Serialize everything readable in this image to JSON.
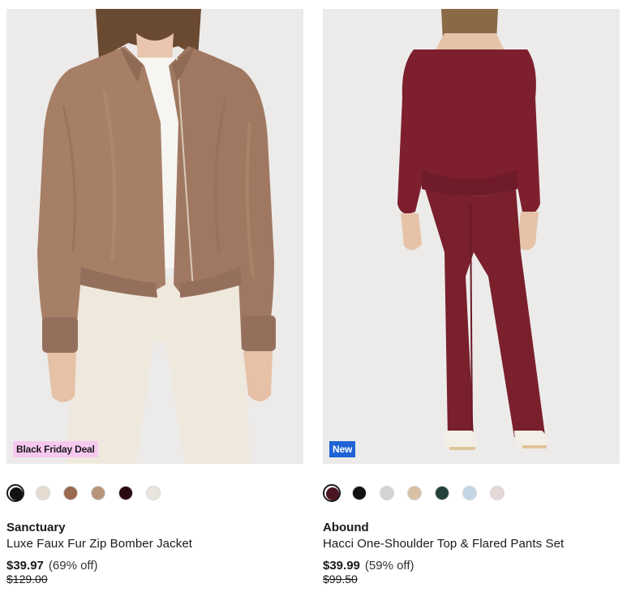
{
  "products": [
    {
      "badge": "Black Friday Deal",
      "brand": "Sanctuary",
      "name": "Luxe Faux Fur Zip Bomber Jacket",
      "price": "$39.97",
      "discount": "(69% off)",
      "original_price": "$129.00",
      "swatch_colors": [
        "#111111",
        "#e6ddd0",
        "#9a6a50",
        "#b8957a",
        "#2a0a10",
        "#e9e4dc"
      ],
      "selected_swatch": 0
    },
    {
      "badge": "New",
      "brand": "Abound",
      "name": "Hacci One-Shoulder Top & Flared Pants Set",
      "price": "$39.99",
      "discount": "(59% off)",
      "original_price": "$99.50",
      "swatch_colors": [
        "#4a1420",
        "#111111",
        "#d3d3d3",
        "#d8c0a4",
        "#23403a",
        "#c4d6e6",
        "#e6d8d6"
      ],
      "selected_swatch": 0
    }
  ]
}
